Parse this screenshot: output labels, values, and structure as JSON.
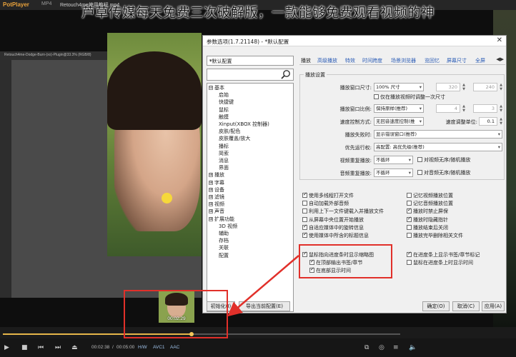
{
  "overlay_title": "芦草传媒每天免费三次破解版，一款能够免费观看视频的神",
  "player": {
    "logo": "PotPlayer",
    "tab_format": "MP4",
    "file_title": "Retouch4me使用教程.mp4",
    "psd_tab_text": "Retouch4me-Dodge-Burn-(xx)-Plugin@33.3% (RGB/8)",
    "thumb_time": "00:02:29",
    "seek_fraction": 0.475,
    "time_current": "00:02:38",
    "time_sep": "/",
    "time_total": "00:05:00",
    "hw_label": "H/W",
    "video_codec": "AVC1",
    "audio_codec": "AAC"
  },
  "dialog": {
    "title": "参数选项(1.7.21148) - *默认配置",
    "close": "✕",
    "preset": "*默认配置",
    "search_placeholder": "",
    "tree": [
      {
        "label": "基本",
        "expander": "⊟",
        "indent": 0
      },
      {
        "label": "启始",
        "indent": 1
      },
      {
        "label": "快捷键",
        "indent": 1
      },
      {
        "label": "鼠标",
        "indent": 1
      },
      {
        "label": "触摸",
        "indent": 1
      },
      {
        "label": "Xinput(XBOX 控制器)",
        "indent": 1
      },
      {
        "label": "皮肤/配色",
        "indent": 1
      },
      {
        "label": "皮肤覆盖/放大",
        "indent": 1
      },
      {
        "label": "播标",
        "indent": 1
      },
      {
        "label": "简索",
        "indent": 1
      },
      {
        "label": "消息",
        "indent": 1
      },
      {
        "label": "界面",
        "indent": 1
      },
      {
        "label": "播放",
        "expander": "⊞",
        "indent": 0
      },
      {
        "label": "字幕",
        "expander": "⊞",
        "indent": 0
      },
      {
        "label": "设备",
        "expander": "⊞",
        "indent": 0
      },
      {
        "label": "滤镜",
        "expander": "⊞",
        "indent": 0
      },
      {
        "label": "视频",
        "expander": "⊞",
        "indent": 0
      },
      {
        "label": "声音",
        "expander": "⊞",
        "indent": 0
      },
      {
        "label": "扩展功能",
        "expander": "⊞",
        "indent": 0
      },
      {
        "label": "3D 视频",
        "indent": 1
      },
      {
        "label": "辅助",
        "indent": 1
      },
      {
        "label": "存档",
        "indent": 1
      },
      {
        "label": "关联",
        "indent": 1
      },
      {
        "label": "配置",
        "indent": 1
      }
    ],
    "tabs": [
      "播放",
      "高级播放",
      "特效",
      "时间跨度",
      "场景浏览器",
      "览回忆",
      "屏幕尺寸",
      "全屏"
    ],
    "tab_scroll": "◀▶",
    "group_title": "播放设置",
    "window_size": {
      "label": "播放窗口尺寸:",
      "value": "100% 尺寸",
      "w": "320",
      "h": "240"
    },
    "chk_keep_video_size": "仅在播放视频时调整一次尺寸",
    "aspect": {
      "label": "播放窗口比例:",
      "value": "保持原样(推荐)",
      "a": "4",
      "b": "3"
    },
    "speed": {
      "label": "速度控制方式:",
      "value": "无回音速度控制(推",
      "unit_label": "速度调整单位:",
      "unit_value": "0.1"
    },
    "failure": {
      "label": "播放失败时:",
      "value": "显示错误窗口(推荐)"
    },
    "priority": {
      "label": "优先运行权:",
      "value": "高配置: 高优先级(推荐)"
    },
    "video_repeat": {
      "label": "视频重复播放:",
      "value": "不循环",
      "chk": "对视频无序/随机播放"
    },
    "audio_repeat": {
      "label": "音频重复播放:",
      "value": "不循环",
      "chk": "对音频无序/随机播放"
    },
    "checks_left": [
      {
        "label": "使用多线程打开文件",
        "on": true
      },
      {
        "label": "自动加载外部音频",
        "on": false
      },
      {
        "label": "利用上下一文件键载入并播放文件",
        "on": false
      },
      {
        "label": "从屏幕中央位置开始播放",
        "on": false
      },
      {
        "label": "自适应媒体中的旋转信息",
        "on": true
      },
      {
        "label": "使用媒体中所含的标题信息",
        "on": true
      }
    ],
    "checks_right": [
      {
        "label": "记忆视频播放位置",
        "on": false
      },
      {
        "label": "记忆音频播放位置",
        "on": false
      },
      {
        "label": "播放时禁止屏保",
        "on": true
      },
      {
        "label": "播放时隐藏指针",
        "on": true
      },
      {
        "label": "播放结束后关闭",
        "on": false
      },
      {
        "label": "播放完毕删除相关文件",
        "on": false
      }
    ],
    "seek_preview": {
      "label": "鼠标指向进度条时显示缩略图",
      "on": true
    },
    "seek_preview_sub1": {
      "label": "在顶部输出书签/章节",
      "on": true
    },
    "seek_preview_sub2": {
      "label": "在底部显示时间",
      "on": true
    },
    "bottom_right_1": {
      "label": "在进度条上显示书签/章节标记",
      "on": true
    },
    "bottom_right_2": {
      "label": "鼠标在进度条上时显示时间",
      "on": false
    },
    "btn_init": "初始化(I)",
    "btn_export": "导出当前配置(E)",
    "btn_ok": "确定(O)",
    "btn_cancel": "取消(C)",
    "btn_apply": "应用(A)"
  },
  "colors": {
    "accent": "#e1302a",
    "player_bg": "#1b1b1b",
    "seek": "#e6b64a"
  }
}
